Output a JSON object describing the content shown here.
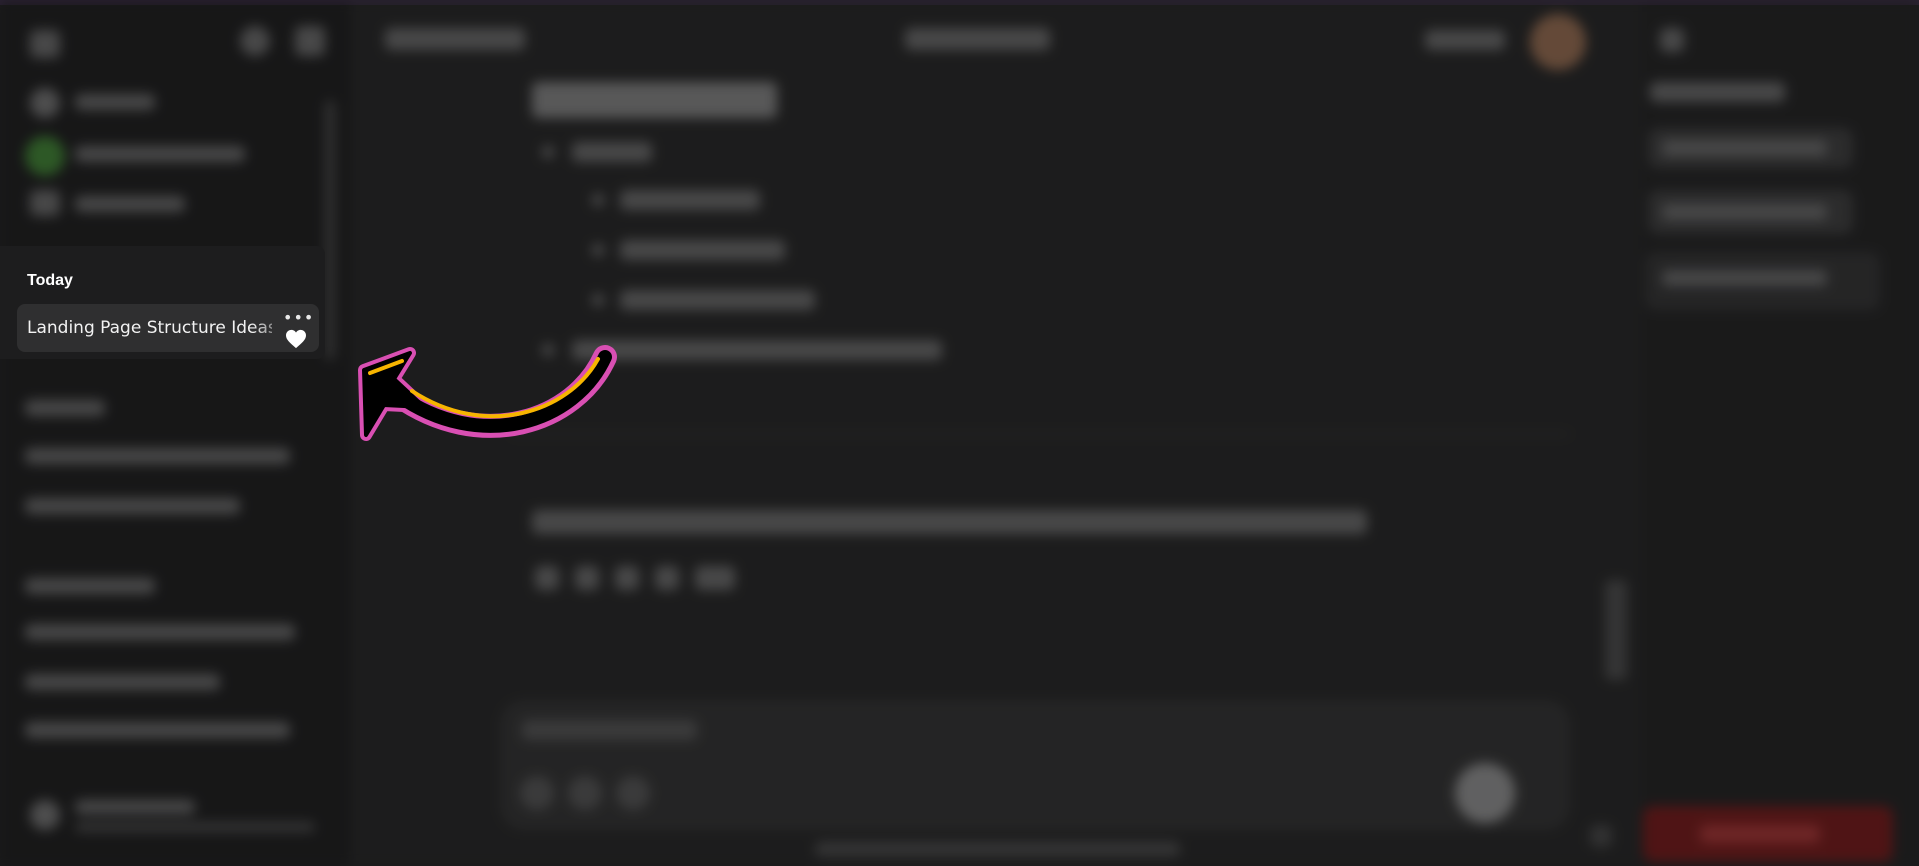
{
  "sidebar": {
    "section_label": "Today",
    "active_chat": {
      "title": "Landing Page Structure Ideas",
      "more_icon": "more-horizontal-icon",
      "favorite_icon": "heart-icon"
    }
  },
  "annotation": {
    "arrow_icon": "pointer-arrow-icon",
    "colors": {
      "outline": "#d94fb3",
      "fill": "#000000",
      "accent": "#f7b500"
    }
  }
}
